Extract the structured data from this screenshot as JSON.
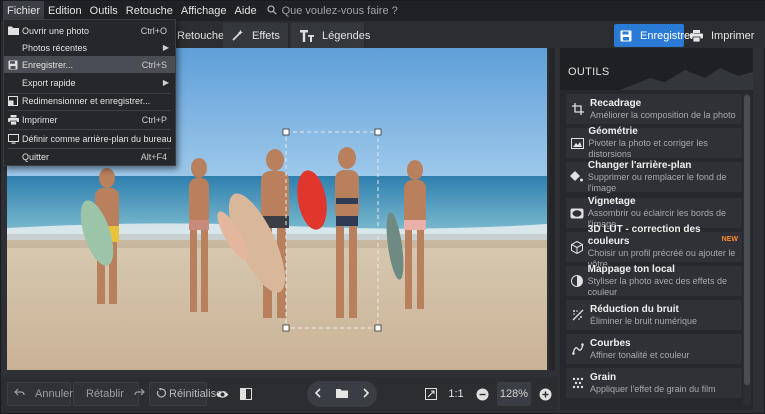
{
  "menubar": {
    "items": [
      "Fichier",
      "Edition",
      "Outils",
      "Retouche",
      "Affichage",
      "Aide"
    ],
    "search_placeholder": "Que voulez-vous faire ?"
  },
  "toolbar": {
    "tabs": [
      {
        "label": "Retouche",
        "icon": "brush-icon"
      },
      {
        "label": "Effets",
        "icon": "magic-wand-icon"
      },
      {
        "label": "Légendes",
        "icon": "text-icon"
      }
    ],
    "save_label": "Enregistrer",
    "print_label": "Imprimer"
  },
  "file_menu": [
    {
      "label": "Ouvrir une photo",
      "shortcut": "Ctrl+O",
      "icon": "folder-icon"
    },
    {
      "label": "Photos récentes",
      "submenu": true
    },
    {
      "label": "Enregistrer...",
      "shortcut": "Ctrl+S",
      "icon": "save-icon",
      "highlighted": true
    },
    {
      "label": "Export rapide",
      "submenu": true
    },
    {
      "label": "Redimensionner et enregistrer...",
      "icon": "resize-icon"
    },
    {
      "label": "Imprimer",
      "shortcut": "Ctrl+P",
      "icon": "printer-icon"
    },
    {
      "label": "Définir comme arrière-plan du bureau",
      "icon": "monitor-icon"
    },
    {
      "label": "Quitter",
      "shortcut": "Alt+F4"
    }
  ],
  "panel": {
    "title": "OUTILS",
    "tools": [
      {
        "title": "Recadrage",
        "desc": "Améliorer la composition de la photo",
        "icon": "crop-icon"
      },
      {
        "title": "Géométrie",
        "desc": "Pivoter la photo et corriger les distorsions",
        "icon": "geometry-icon"
      },
      {
        "title": "Changer l'arrière-plan",
        "desc": "Supprimer ou remplacer le fond de l'image",
        "icon": "fill-icon"
      },
      {
        "title": "Vignetage",
        "desc": "Assombrir ou éclaircir les bords de l'image",
        "icon": "vignette-icon"
      },
      {
        "title": "3D LUT - correction des couleurs",
        "desc": "Choisir un profil précréé ou ajouter le vôtre",
        "icon": "cube-icon",
        "badge": "NEW"
      },
      {
        "title": "Mappage ton local",
        "desc": "Styliser la photo avec des effets de couleur",
        "icon": "tone-icon"
      },
      {
        "title": "Réduction du bruit",
        "desc": "Éliminer le bruit numérique",
        "icon": "noise-icon"
      },
      {
        "title": "Courbes",
        "desc": "Affiner tonalité et couleur",
        "icon": "curves-icon"
      },
      {
        "title": "Grain",
        "desc": "Appliquer l'effet de grain du film",
        "icon": "grain-icon"
      }
    ]
  },
  "bottombar": {
    "undo_label": "Annuler",
    "redo_label": "Rétablir",
    "reset_label": "Réinitialiser",
    "zoom_fit_label": "1:1",
    "zoom_value": "128%"
  },
  "colors": {
    "accent": "#2a7bd6",
    "new_badge": "#ff8a2b"
  }
}
